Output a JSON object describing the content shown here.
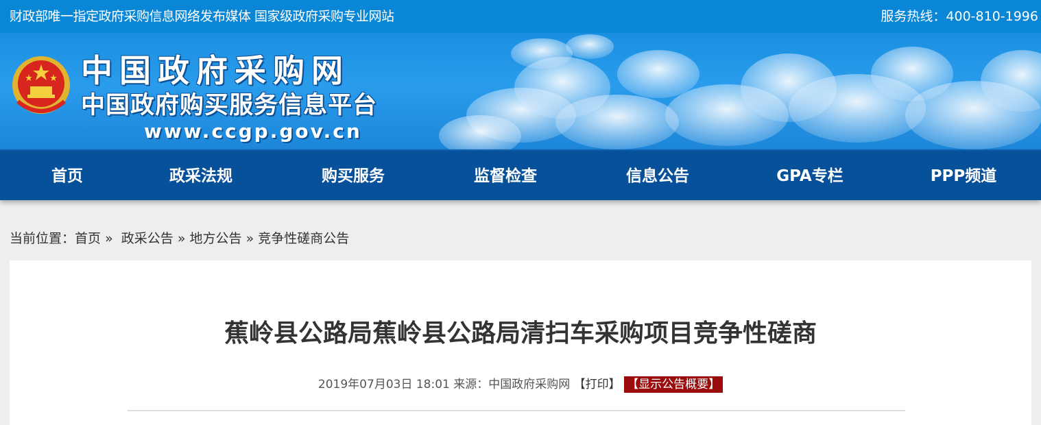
{
  "topbar": {
    "slogan": "财政部唯一指定政府采购信息网络发布媒体 国家级政府采购专业网站",
    "hotline": "服务热线：400-810-1996"
  },
  "banner": {
    "name": "中国政府采购网",
    "subname": "中国政府购买服务信息平台",
    "url": "www.ccgp.gov.cn"
  },
  "nav": {
    "items": [
      {
        "label": "首页"
      },
      {
        "label": "政采法规"
      },
      {
        "label": "购买服务"
      },
      {
        "label": "监督检查"
      },
      {
        "label": "信息公告"
      },
      {
        "label": "GPA专栏"
      },
      {
        "label": "PPP频道"
      }
    ]
  },
  "breadcrumb": {
    "prefix": "当前位置：",
    "items": [
      "首页",
      "政采公告",
      "地方公告",
      "竞争性磋商公告"
    ],
    "separator": "»"
  },
  "article": {
    "title": "蕉岭县公路局蕉岭县公路局清扫车采购项目竞争性磋商",
    "datetime": "2019年07月03日 18:01",
    "source_label": "来源：",
    "source": "中国政府采购网",
    "print_label": "【打印】",
    "summary_label": "【显示公告概要】"
  },
  "colors": {
    "topbar": "#0a86d6",
    "nav": "#07509a",
    "summary_badge": "#9a0b0b"
  }
}
